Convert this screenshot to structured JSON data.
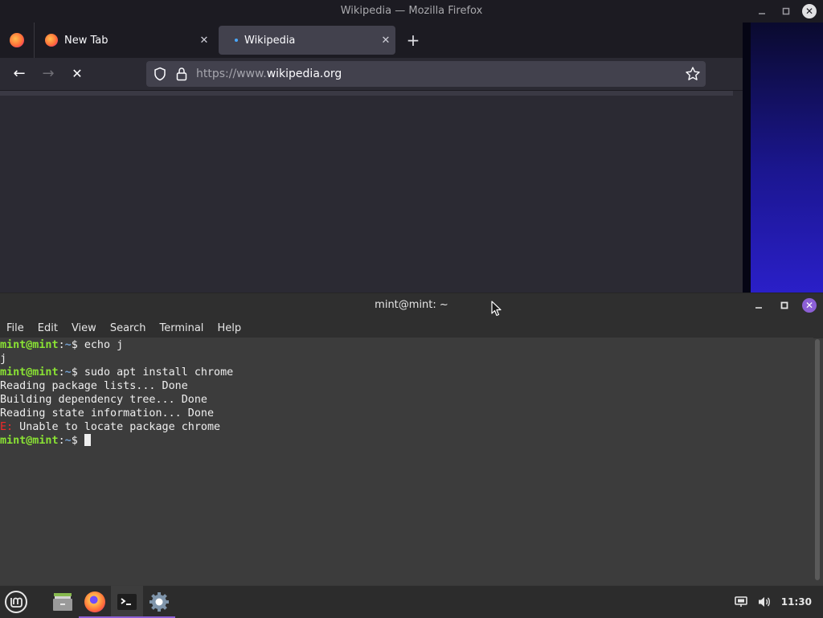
{
  "firefox": {
    "window_title": "Wikipedia — Mozilla Firefox",
    "tabs": [
      {
        "label": "New Tab"
      },
      {
        "label": "Wikipedia"
      }
    ],
    "tab_close_glyph": "✕",
    "new_tab_glyph": "+",
    "url_prefix": "https://www.",
    "url_domain": "wikipedia.org",
    "nav": {
      "back": "←",
      "forward": "→",
      "stop": "✕"
    }
  },
  "terminal": {
    "window_title": "mint@mint: ~",
    "menu": [
      "File",
      "Edit",
      "View",
      "Search",
      "Terminal",
      "Help"
    ],
    "prompt_user": "mint@mint",
    "prompt_sep": ":",
    "prompt_path": "~",
    "prompt_end": "$ ",
    "lines": [
      {
        "type": "prompt",
        "cmd": "echo j"
      },
      {
        "type": "out",
        "text": "j"
      },
      {
        "type": "prompt",
        "cmd": "sudo apt install chrome"
      },
      {
        "type": "out",
        "text": "Reading package lists... Done"
      },
      {
        "type": "out",
        "text": "Building dependency tree... Done"
      },
      {
        "type": "out",
        "text": "Reading state information... Done"
      },
      {
        "type": "err",
        "prefix": "E:",
        "text": " Unable to locate package chrome"
      },
      {
        "type": "prompt",
        "cmd": ""
      }
    ]
  },
  "taskbar": {
    "clock": "11:30"
  },
  "colors": {
    "prompt_green": "#8ae234",
    "prompt_blue": "#729fcf",
    "error_red": "#ef2929",
    "accent_purple": "#8c5fd6"
  }
}
